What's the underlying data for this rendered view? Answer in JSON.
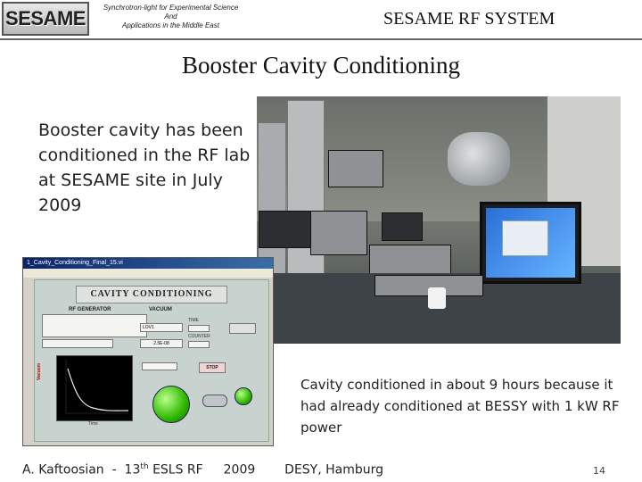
{
  "header": {
    "logo_text": "SESAME",
    "tagline_lines": [
      "Synchrotron-light for Experimental Science",
      "And",
      "Applications in the Middle East"
    ],
    "title": "SESAME RF SYSTEM"
  },
  "main": {
    "title": "Booster Cavity Conditioning",
    "body_text": "Booster cavity has been conditioned in the RF lab at SESAME site in July 2009",
    "caption": "Cavity conditioned in about 9 hours because it had already conditioned at BESSY with 1 kW RF power"
  },
  "vi_screenshot": {
    "window_title": "1_Cavity_Conditioning_Final_15.vi",
    "panel_title": "CAVITY CONDITIONING",
    "rf_generator_label": "RF GENERATOR",
    "vacuum_label": "VACUUM",
    "vacuum_value": "2.5E-08",
    "vacuum_field": "LOV1",
    "time_label": "TIME",
    "counter_label": "COUNTER",
    "stop_label": "STOP",
    "graph_x_label": "Time",
    "graph_y_label": "Vacuum"
  },
  "footer": {
    "author": "A. Kaftoosian",
    "event_prefix": "13",
    "event_suffix": "th",
    "event_name": "ESLS RF",
    "year": "2009",
    "location": "DESY, Hamburg",
    "page_number": "14"
  }
}
